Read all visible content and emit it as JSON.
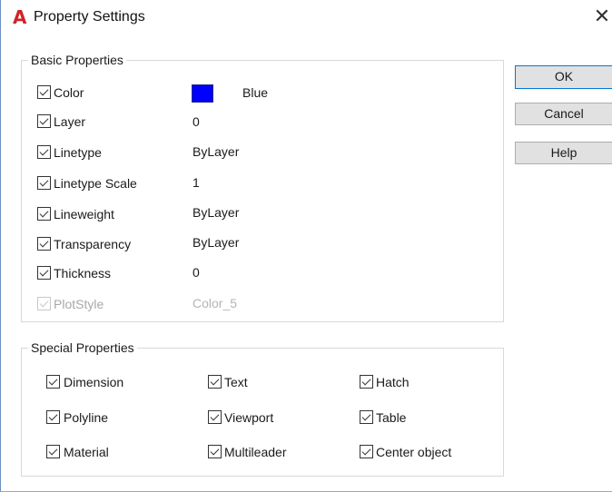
{
  "window": {
    "title": "Property Settings",
    "app_icon": "A",
    "close_glyph": "✕"
  },
  "basic": {
    "legend": "Basic Properties",
    "rows": [
      {
        "label": "Color",
        "value": "Blue",
        "checked": true,
        "enabled": true,
        "swatch_color": "#0000ff"
      },
      {
        "label": "Layer",
        "value": "0",
        "checked": true,
        "enabled": true
      },
      {
        "label": "Linetype",
        "value": "ByLayer",
        "checked": true,
        "enabled": true
      },
      {
        "label": "Linetype Scale",
        "value": "1",
        "checked": true,
        "enabled": true
      },
      {
        "label": "Lineweight",
        "value": "ByLayer",
        "checked": true,
        "enabled": true
      },
      {
        "label": "Transparency",
        "value": "ByLayer",
        "checked": true,
        "enabled": true
      },
      {
        "label": "Thickness",
        "value": "0",
        "checked": true,
        "enabled": true
      },
      {
        "label": "PlotStyle",
        "value": "Color_5",
        "checked": true,
        "enabled": false
      }
    ]
  },
  "special": {
    "legend": "Special Properties",
    "items": [
      {
        "label": "Dimension",
        "checked": true
      },
      {
        "label": "Text",
        "checked": true
      },
      {
        "label": "Hatch",
        "checked": true
      },
      {
        "label": "Polyline",
        "checked": true
      },
      {
        "label": "Viewport",
        "checked": true
      },
      {
        "label": "Table",
        "checked": true
      },
      {
        "label": "Material",
        "checked": true
      },
      {
        "label": "Multileader",
        "checked": true
      },
      {
        "label": "Center object",
        "checked": true
      }
    ]
  },
  "buttons": {
    "ok": "OK",
    "cancel": "Cancel",
    "help": "Help"
  },
  "colors": {
    "accent": "#0078d7",
    "app_icon": "#d0232a"
  }
}
